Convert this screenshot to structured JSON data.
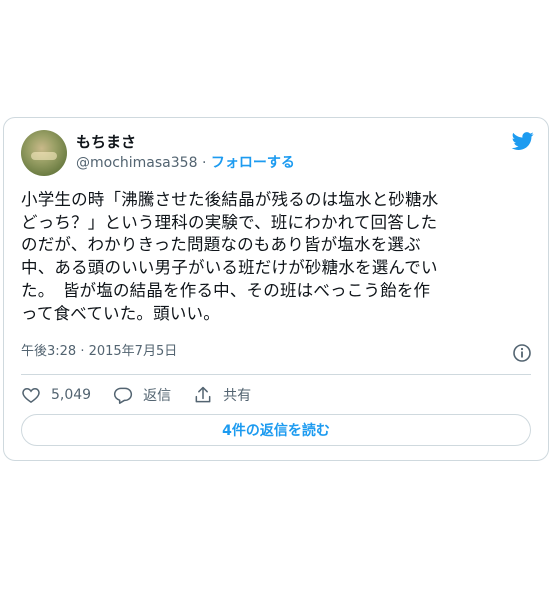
{
  "user": {
    "display_name": "もちまさ",
    "handle": "@mochimasa358",
    "separator": "·",
    "follow_label": "フォローする"
  },
  "tweet": {
    "lines": [
      "小学生の時「沸騰させた後結晶が残るのは塩水と砂糖水",
      "どっち？」という理科の実験で、班にわかれて回答した",
      "のだが、わかりきった問題なのもあり皆が塩水を選ぶ",
      "中、ある頭のいい男子がいる班だけが砂糖水を選んでい",
      "た。　皆が塩の結晶を作る中、その班はべっこう飴を作",
      "って食べていた。頭いい。"
    ],
    "timestamp": "午後3:28 · 2015年7月5日"
  },
  "actions": {
    "likes": "5,049",
    "reply_label": "返信",
    "share_label": "共有"
  },
  "read_replies_label": "4件の返信を読む",
  "colors": {
    "accent": "#1d9bf0",
    "secondary_text": "#536471",
    "border": "#cfd9de"
  },
  "icons": [
    "twitter-bird-icon",
    "info-icon",
    "heart-icon",
    "reply-icon",
    "share-icon"
  ]
}
